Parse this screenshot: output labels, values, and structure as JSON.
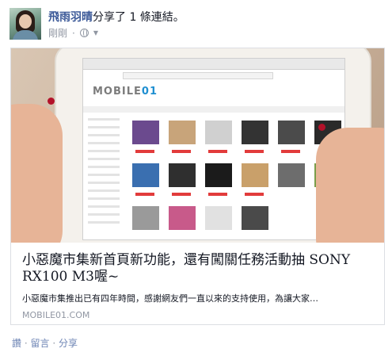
{
  "post": {
    "author": "飛雨羽晴",
    "action_text": "分享了 1 條連結。",
    "timestamp": "剛剛",
    "audience_icon": "globe-icon",
    "audience_caret_icon": "caret-down-icon"
  },
  "link_card": {
    "title": "小惡魔市集新首頁新功能，還有闖關任務活動抽 SONY RX100 M3喔~",
    "description": "小惡魔市集推出已有四年時間，感謝網友們一直以來的支持使用，為讓大家…",
    "domain": "MOBILE01.COM"
  },
  "actions": {
    "like": "讚",
    "separator": "·",
    "comment": "留言",
    "share": "分享"
  },
  "colors": {
    "author_link": "#3b5998",
    "meta_text": "#9197a3",
    "action_link": "#6d84b4",
    "card_border": "#dcdee3"
  }
}
